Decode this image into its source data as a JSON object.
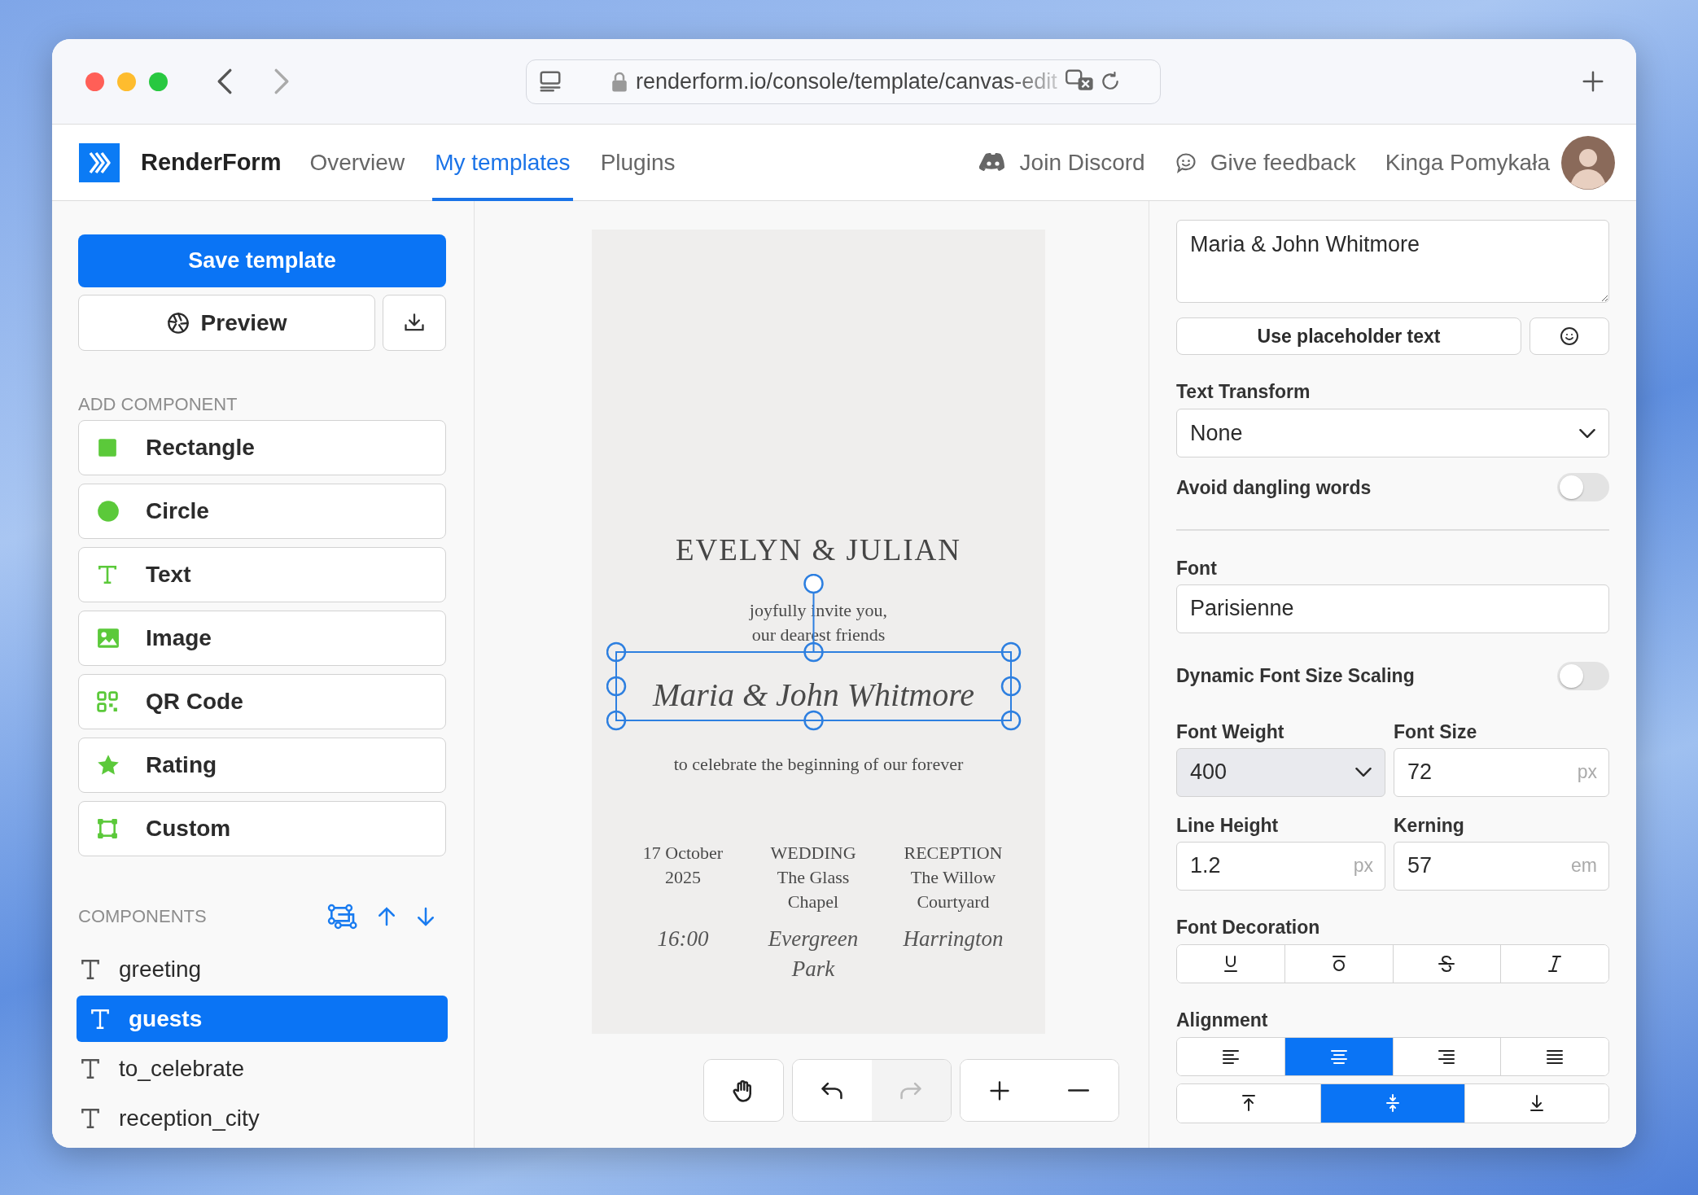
{
  "browser": {
    "url": "renderform.io/console/template/canvas-edit"
  },
  "app": {
    "logo_text": "RenderForm",
    "nav": [
      {
        "label": "Overview",
        "selected": false
      },
      {
        "label": "My templates",
        "selected": true
      },
      {
        "label": "Plugins",
        "selected": false
      }
    ],
    "links": [
      {
        "kind": "discord",
        "label": "Join Discord"
      },
      {
        "kind": "feedback",
        "label": "Give feedback"
      }
    ],
    "user": "Kinga Pomykała"
  },
  "sidebar": {
    "save": "Save template",
    "preview": "Preview",
    "add_heading": "ADD COMPONENT",
    "add_items": [
      {
        "kind": "rectangle",
        "label": "Rectangle"
      },
      {
        "kind": "circle",
        "label": "Circle"
      },
      {
        "kind": "text",
        "label": "Text"
      },
      {
        "kind": "image",
        "label": "Image"
      },
      {
        "kind": "qr",
        "label": "QR Code"
      },
      {
        "kind": "rating",
        "label": "Rating"
      },
      {
        "kind": "custom",
        "label": "Custom"
      }
    ],
    "components_heading": "COMPONENTS",
    "components": [
      {
        "label": "greeting",
        "selected": false
      },
      {
        "label": "guests",
        "selected": true
      },
      {
        "label": "to_celebrate",
        "selected": false
      },
      {
        "label": "reception_city",
        "selected": false
      }
    ]
  },
  "canvas": {
    "title": "EVELYN & JULIAN",
    "intro": [
      "joyfully invite you,",
      "our dearest friends"
    ],
    "guests": {
      "text": "Maria & John Whitmore",
      "selected": true
    },
    "subtitle": "to celebrate the beginning of our forever",
    "columns": [
      {
        "lines": [
          "17 October",
          "2025"
        ],
        "script": [
          "16:00"
        ]
      },
      {
        "lines": [
          "WEDDING",
          "The Glass",
          "Chapel"
        ],
        "script": [
          "Evergreen",
          "Park"
        ]
      },
      {
        "lines": [
          "RECEPTION",
          "The Willow",
          "Courtyard"
        ],
        "script": [
          "Harrington"
        ]
      }
    ]
  },
  "toolbar": [
    [
      {
        "kind": "hand",
        "disabled": false
      }
    ],
    [
      {
        "kind": "undo",
        "disabled": false
      },
      {
        "kind": "redo",
        "disabled": true
      }
    ],
    [
      {
        "kind": "zoom_in",
        "disabled": false
      },
      {
        "kind": "zoom_out",
        "disabled": false
      }
    ]
  ],
  "properties": {
    "text_value": "Maria & John Whitmore",
    "placeholder_button": "Use placeholder text",
    "text_transform": {
      "label": "Text Transform",
      "value": "None"
    },
    "avoid_dangling": {
      "label": "Avoid dangling words",
      "on": false
    },
    "font": {
      "label": "Font",
      "value": "Parisienne"
    },
    "dynamic_scaling": {
      "label": "Dynamic Font Size Scaling",
      "on": false
    },
    "font_weight": {
      "label": "Font Weight",
      "value": "400"
    },
    "font_size": {
      "label": "Font Size",
      "value": "72",
      "unit": "px"
    },
    "line_height": {
      "label": "Line Height",
      "value": "1.2",
      "unit": "px"
    },
    "kerning": {
      "label": "Kerning",
      "value": "57",
      "unit": "em"
    },
    "decoration": {
      "label": "Font Decoration",
      "options": [
        {
          "kind": "underline",
          "selected": false
        },
        {
          "kind": "overline",
          "selected": false
        },
        {
          "kind": "strikethrough",
          "selected": false
        },
        {
          "kind": "italic",
          "selected": false
        }
      ]
    },
    "alignment": {
      "label": "Alignment",
      "horizontal": [
        {
          "kind": "left",
          "selected": false
        },
        {
          "kind": "center",
          "selected": true
        },
        {
          "kind": "right",
          "selected": false
        },
        {
          "kind": "justify",
          "selected": false
        }
      ],
      "vertical": [
        {
          "kind": "top",
          "selected": false
        },
        {
          "kind": "middle",
          "selected": true
        },
        {
          "kind": "bottom",
          "selected": false
        }
      ]
    }
  }
}
